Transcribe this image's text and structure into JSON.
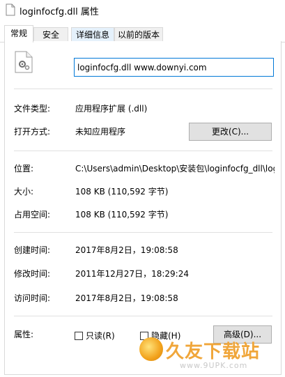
{
  "window": {
    "title": "loginfocfg.dll 属性"
  },
  "tabs": [
    {
      "label": "常规",
      "active": true
    },
    {
      "label": "安全",
      "active": false
    },
    {
      "label": "详细信息",
      "active": false
    },
    {
      "label": "以前的版本",
      "active": false
    }
  ],
  "general": {
    "file_icon": "dll-gear-file-icon",
    "file_name": "loginfocfg.dll www.downyi.com",
    "file_type_label": "文件类型:",
    "file_type_value": "应用程序扩展 (.dll)",
    "opens_with_label": "打开方式:",
    "opens_with_value": "未知应用程序",
    "change_button": "更改(C)...",
    "location_label": "位置:",
    "location_value": "C:\\Users\\admin\\Desktop\\安装包\\loginfocfg_dll\\log",
    "size_label": "大小:",
    "size_value": "108 KB (110,592 字节)",
    "size_on_disk_label": "占用空间:",
    "size_on_disk_value": "108 KB (110,592 字节)",
    "created_label": "创建时间:",
    "created_value": "2017年8月2日，19:08:58",
    "modified_label": "修改时间:",
    "modified_value": "2011年12月27日，18:29:24",
    "accessed_label": "访问时间:",
    "accessed_value": "2017年8月2日，19:08:58",
    "attributes_label": "属性:",
    "readonly_label": "只读(R)",
    "readonly_checked": false,
    "hidden_label": "隐藏(H)",
    "hidden_checked": false,
    "advanced_button": "高级(D)..."
  },
  "watermark": {
    "title": "久友下载站",
    "url": "www.9UPK.com"
  },
  "colors": {
    "accent_border": "#0078d7",
    "button_bg": "#e1e1e1",
    "watermark_orange": "#f0a63a"
  }
}
